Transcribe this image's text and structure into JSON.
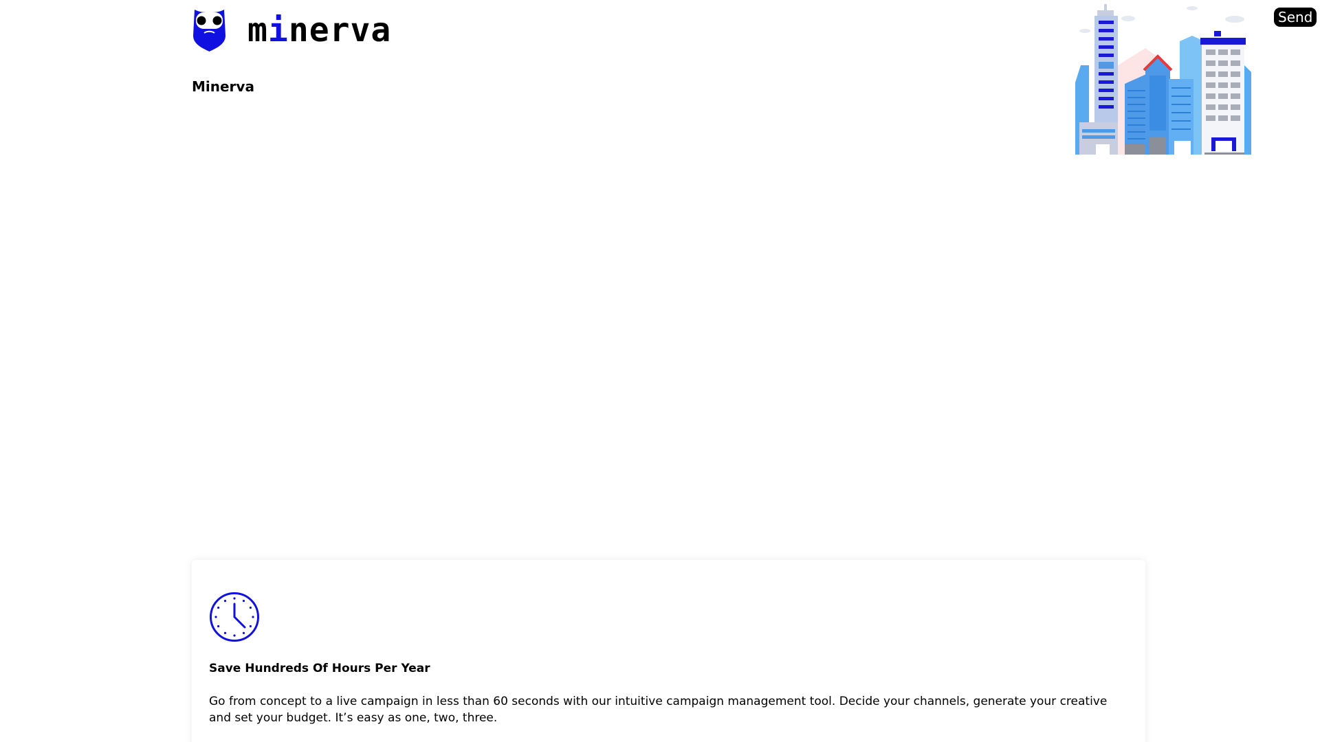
{
  "header": {
    "logo_word_prefix": "m",
    "logo_word_accent": "i",
    "logo_word_suffix": "nerva",
    "site_name": "Minerva",
    "send_label": "Send"
  },
  "feature": {
    "icon": "clock-icon",
    "title": "Save Hundreds Of Hours Per Year",
    "text": "Go from concept to a live campaign in less than 60 seconds with our intuitive campaign management tool. Decide your channels, generate your creative and set your budget. It’s easy as one, two, three."
  },
  "colors": {
    "brand": "#1010e0",
    "text": "#000000",
    "button_bg": "#000000",
    "button_text": "#ffffff"
  }
}
